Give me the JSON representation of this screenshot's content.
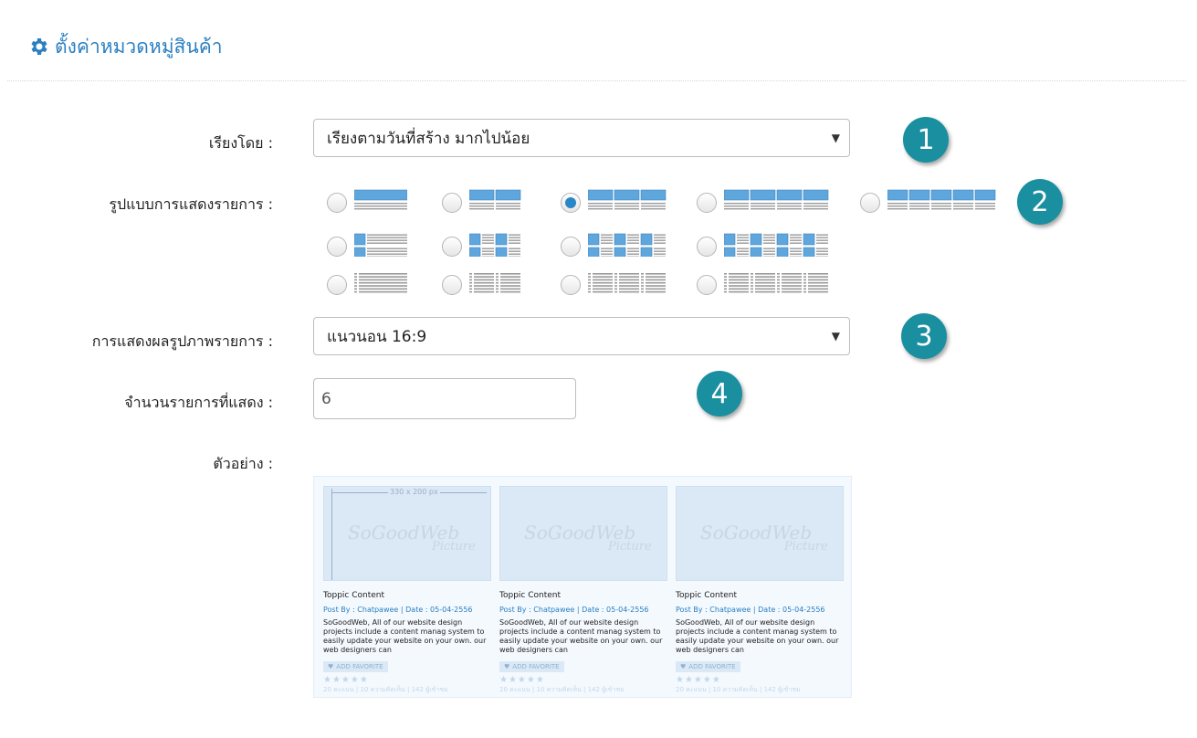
{
  "header": {
    "title": "ตั้งค่าหมวดหมู่สินค้า",
    "icon": "gear-icon",
    "color": "#2a7fc1"
  },
  "form": {
    "sort": {
      "label": "เรียงโดย :",
      "value": "เรียงตามวันที่สร้าง มากไปน้อย"
    },
    "layout": {
      "label": "รูปแบบการแสดงรายการ :",
      "selected": "grid-3",
      "options": [
        "list-1",
        "grid-2",
        "grid-3",
        "grid-4",
        "grid-5",
        "thumb-list-1",
        "thumb-list-2",
        "thumb-list-3",
        "thumb-list-4",
        "text-list-1",
        "text-list-2",
        "text-list-3",
        "text-list-4"
      ]
    },
    "image_display": {
      "label": "การแสดงผลรูปภาพรายการ :",
      "value": "แนวนอน 16:9"
    },
    "item_count": {
      "label": "จำนวนรายการที่แสดง :",
      "value": "6"
    },
    "preview": {
      "label": "ตัวอย่าง :"
    }
  },
  "badges": [
    "1",
    "2",
    "3",
    "4"
  ],
  "badge_color": "#1a8fa0",
  "preview_cards": [
    {
      "size_label": "330 x 200 px",
      "watermark": "SoGoodWeb",
      "watermark_sub": "Picture",
      "title": "Toppic Content",
      "meta": "Post By : Chatpawee  |  Date : 05-04-2556",
      "desc": "SoGoodWeb, All of our website design projects include a content manag system to easily update your website on your own. our web designers can",
      "fav": "ADD FAVORITE",
      "stars": "★★★★★",
      "stats": "20 คะแนน | 10 ความคิดเห็น | 142 ผู้เข้าชม"
    },
    {
      "size_label": "",
      "watermark": "SoGoodWeb",
      "watermark_sub": "Picture",
      "title": "Toppic Content",
      "meta": "Post By : Chatpawee  |  Date : 05-04-2556",
      "desc": "SoGoodWeb, All of our website design projects include a content manag system to easily update your website on your own. our web designers can",
      "fav": "ADD FAVORITE",
      "stars": "★★★★★",
      "stats": "20 คะแนน | 10 ความคิดเห็น | 142 ผู้เข้าชม"
    },
    {
      "size_label": "",
      "watermark": "SoGoodWeb",
      "watermark_sub": "Picture",
      "title": "Toppic Content",
      "meta": "Post By : Chatpawee  |  Date : 05-04-2556",
      "desc": "SoGoodWeb, All of our website design projects include a content manag system to easily update your website on your own. our web designers can",
      "fav": "ADD FAVORITE",
      "stars": "★★★★★",
      "stats": "20 คะแนน | 10 ความคิดเห็น | 142 ผู้เข้าชม"
    }
  ]
}
